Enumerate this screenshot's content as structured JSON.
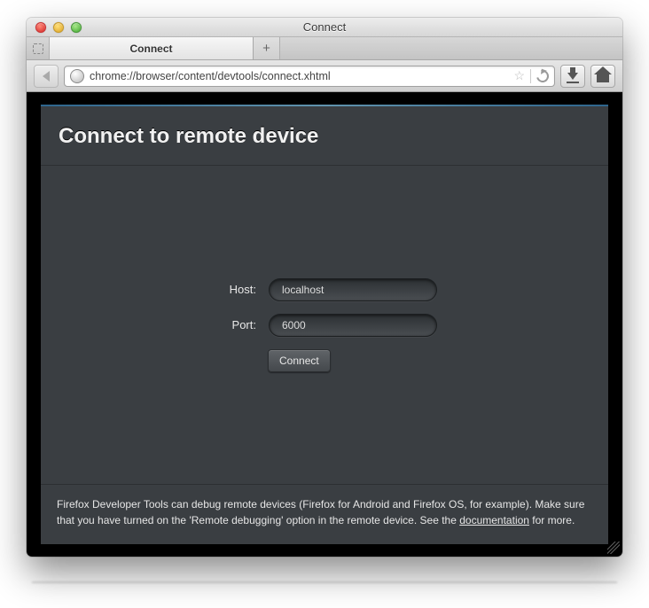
{
  "window": {
    "title": "Connect"
  },
  "tabs": {
    "active_label": "Connect"
  },
  "urlbar": {
    "value": "chrome://browser/content/devtools/connect.xhtml"
  },
  "page": {
    "heading": "Connect to remote device",
    "form": {
      "host_label": "Host:",
      "host_value": "localhost",
      "port_label": "Port:",
      "port_value": "6000",
      "submit_label": "Connect"
    },
    "footer": {
      "text_before": "Firefox Developer Tools can debug remote devices (Firefox for Android and Firefox OS, for example). Make sure that you have turned on the 'Remote debugging' option in the remote device. See the ",
      "link_text": "documentation",
      "text_after": " for more."
    }
  }
}
